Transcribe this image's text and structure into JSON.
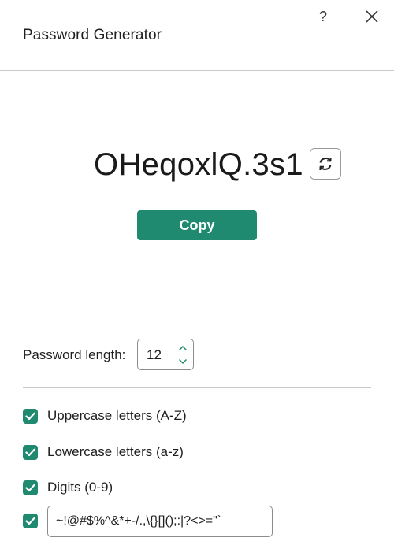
{
  "window": {
    "title": "Password Generator",
    "help_label": "?",
    "help_icon": "question-icon",
    "close_icon": "close-icon"
  },
  "generator": {
    "password": "OHeqoxlQ.3s1",
    "refresh_icon": "refresh-icon",
    "copy_label": "Copy"
  },
  "options": {
    "length_label": "Password length:",
    "length_value": "12",
    "uppercase": {
      "label": "Uppercase letters (A-Z)",
      "checked": true
    },
    "lowercase": {
      "label": "Lowercase letters (a-z)",
      "checked": true
    },
    "digits": {
      "label": "Digits (0-9)",
      "checked": true
    },
    "symbols": {
      "value": "~!@#$%^&*+-/.,\\{}[]();:|?<>=\"`",
      "checked": true
    }
  },
  "colors": {
    "accent": "#1f8a6f",
    "divider": "#c9c9c9",
    "border": "#8c8c8c"
  }
}
